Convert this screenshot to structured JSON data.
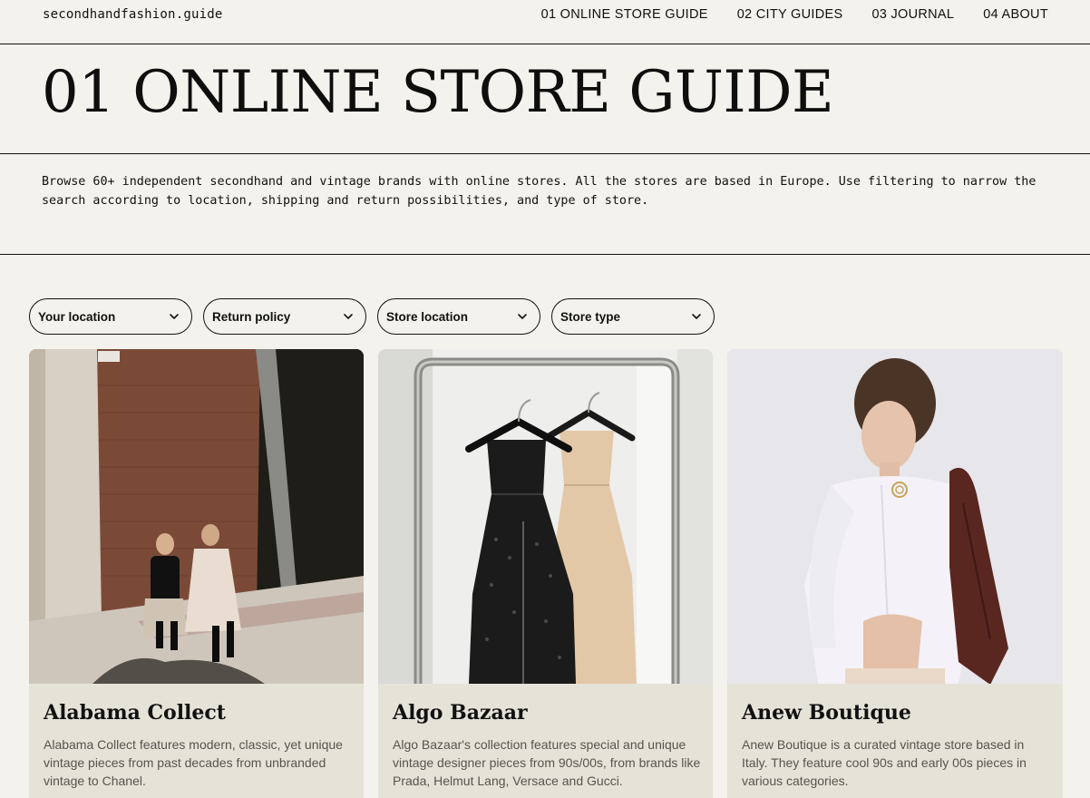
{
  "site": {
    "logo": "secondhandfashion.guide"
  },
  "nav": [
    {
      "label": "01 ONLINE STORE GUIDE"
    },
    {
      "label": "02 CITY GUIDES"
    },
    {
      "label": "03 JOURNAL"
    },
    {
      "label": "04 ABOUT"
    }
  ],
  "page": {
    "title": "01 ONLINE STORE GUIDE",
    "intro": "Browse 60+ independent secondhand and vintage brands with online stores. All the stores are based in Europe. Use filtering to narrow the search according to location, shipping and return possibilities, and type of store."
  },
  "filters": [
    {
      "label": "Your location",
      "icon": "chevron-down-icon"
    },
    {
      "label": "Return policy",
      "icon": "chevron-down-icon"
    },
    {
      "label": "Store location",
      "icon": "chevron-down-icon"
    },
    {
      "label": "Store type",
      "icon": "chevron-down-icon"
    }
  ],
  "stores": [
    {
      "name": "Alabama Collect",
      "description": "Alabama Collect features modern, classic, yet unique vintage pieces from past decades from unbranded vintage to Chanel.",
      "image": "street-photo"
    },
    {
      "name": "Algo Bazaar",
      "description": "Algo Bazaar's collection features special and unique vintage designer pieces from 90s/00s, from brands like Prada, Helmut Lang, Versace and Gucci.",
      "image": "dresses-on-rack-photo"
    },
    {
      "name": "Anew Boutique",
      "description": "Anew Boutique is a curated vintage store based in Italy. They feature cool 90s and early 00s pieces in various categories.",
      "image": "model-photo"
    }
  ],
  "colors": {
    "background": "#f3f2ec",
    "card": "#e5e3d7",
    "text": "#111111",
    "muted": "#55544f"
  }
}
